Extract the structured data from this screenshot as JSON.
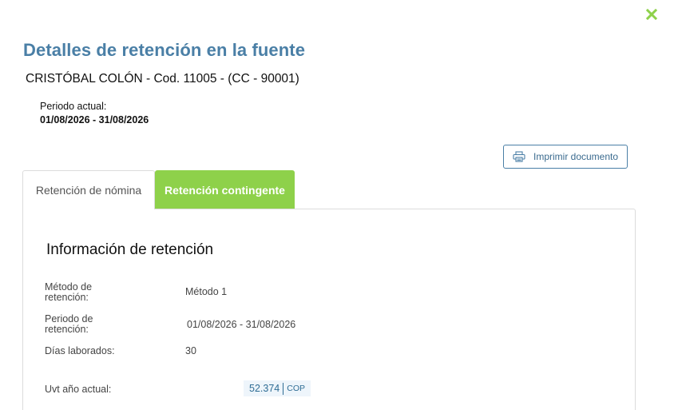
{
  "header": {
    "title": "Detalles de retención en la fuente",
    "employee": "CRISTÓBAL COLÓN - Cod. 11005 - (CC - 90001)",
    "period_label": "Periodo actual:",
    "period_value": "01/08/2026 - 31/08/2026"
  },
  "actions": {
    "close_icon": "close-x-icon",
    "print_label": "Imprimir documento",
    "print_icon": "printer-icon"
  },
  "tabs": [
    {
      "label": "Retención de nómina",
      "active": false
    },
    {
      "label": "Retención contingente",
      "active": true
    }
  ],
  "colors": {
    "title": "#4a7fa6",
    "tab_active": "#8ed14a",
    "close_icon": "#8ed14a",
    "uvt_highlight": "#eef5fb"
  },
  "retention_info": {
    "title": "Información de retención",
    "method_label": "Método de retención:",
    "method_value": "Método 1",
    "period_label": "Periodo de retención:",
    "period_value": "01/08/2026 - 31/08/2026",
    "days_label": "Días laborados:",
    "days_value": "30",
    "uvt_label": "Uvt año actual:",
    "uvt_value": "52.374",
    "uvt_currency": "COP"
  }
}
